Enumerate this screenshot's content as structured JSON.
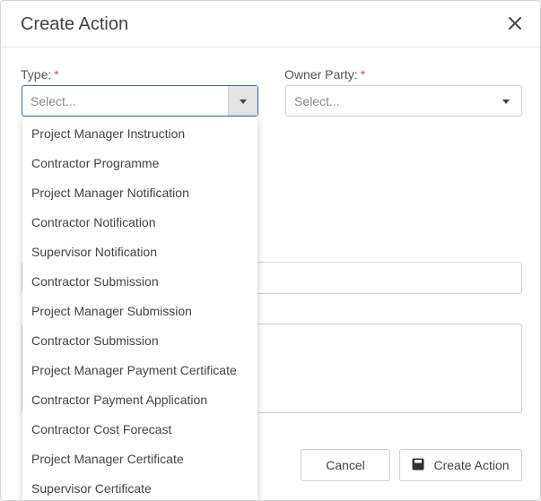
{
  "dialog": {
    "title": "Create Action",
    "close_icon": "close-icon"
  },
  "form": {
    "type_label": "Type:",
    "type_required": "*",
    "type_placeholder": "Select...",
    "owner_label": "Owner Party:",
    "owner_required": "*",
    "owner_placeholder": "Select..."
  },
  "dropdown": {
    "options": [
      "Project Manager Instruction",
      "Contractor Programme",
      "Project Manager Notification",
      "Contractor Notification",
      "Supervisor Notification",
      "Contractor Submission",
      "Project Manager Submission",
      "Contractor Submission",
      "Project Manager Payment Certificate",
      "Contractor Payment Application",
      "Contractor Cost Forecast",
      "Project Manager Certificate",
      "Supervisor Certificate"
    ]
  },
  "footer": {
    "cancel_label": "Cancel",
    "create_label": "Create Action",
    "create_icon": "save-icon"
  },
  "colors": {
    "focus_border": "#3b6ea8",
    "required": "#d9534f"
  }
}
